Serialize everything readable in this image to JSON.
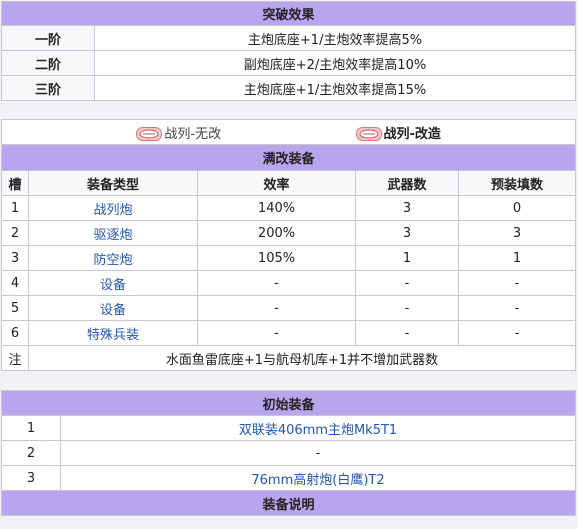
{
  "breakthrough": {
    "title": "突破效果",
    "rows": [
      {
        "tier": "一阶",
        "effect": "主炮底座+1/主炮效率提高5%"
      },
      {
        "tier": "二阶",
        "effect": "副炮底座+2/主炮效率提高10%"
      },
      {
        "tier": "三阶",
        "effect": "主炮底座+1/主炮效率提高15%"
      }
    ]
  },
  "retrofit": {
    "left_label": "战列-无改",
    "right_label": "战列-改造",
    "icon": "ship-type-badge-icon",
    "full_title": "满改装备",
    "columns": [
      "槽",
      "装备类型",
      "效率",
      "武器数",
      "预装填数"
    ],
    "rows": [
      {
        "slot": "1",
        "type": "战列炮",
        "eff": "140%",
        "count": "3",
        "preload": "0"
      },
      {
        "slot": "2",
        "type": "驱逐炮",
        "eff": "200%",
        "count": "3",
        "preload": "3"
      },
      {
        "slot": "3",
        "type": "防空炮",
        "eff": "105%",
        "count": "1",
        "preload": "1"
      },
      {
        "slot": "4",
        "type": "设备",
        "eff": "-",
        "count": "-",
        "preload": "-"
      },
      {
        "slot": "5",
        "type": "设备",
        "eff": "-",
        "count": "-",
        "preload": "-"
      },
      {
        "slot": "6",
        "type": "特殊兵装",
        "eff": "-",
        "count": "-",
        "preload": "-"
      }
    ],
    "note_label": "注",
    "note_text": "水面鱼雷底座+1与航母机库+1并不增加武器数"
  },
  "initial": {
    "title": "初始装备",
    "rows": [
      {
        "slot": "1",
        "item": "双联装406mm主炮Mk5T1"
      },
      {
        "slot": "2",
        "item": "-"
      },
      {
        "slot": "3",
        "item": "76mm高射炮(白鹰)T2"
      }
    ],
    "footer_title": "装备说明"
  },
  "colors": {
    "header": "#b7a6ee",
    "link": "#2457b0"
  }
}
